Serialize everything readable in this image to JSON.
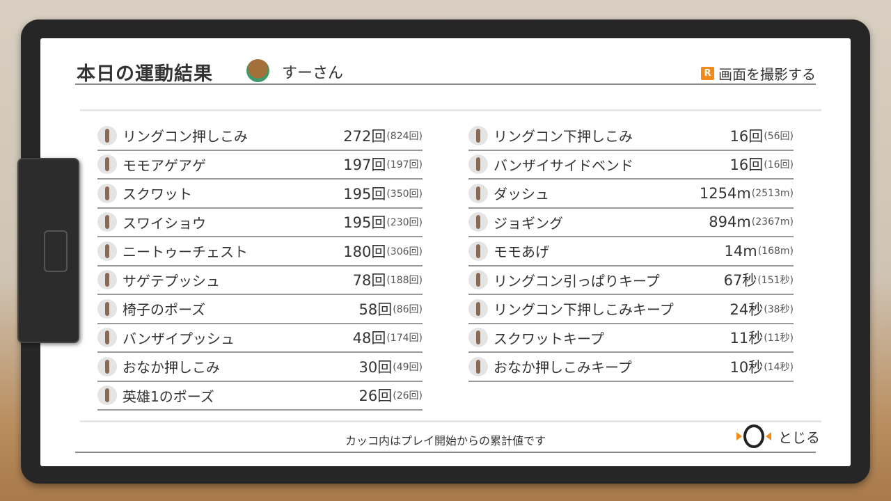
{
  "header": {
    "title": "本日の運動結果",
    "user": "すーさん",
    "screenshot_key": "R",
    "screenshot_label": "画面を撮影する"
  },
  "left": [
    {
      "name": "リングコン押しこみ",
      "value": "272回",
      "total": "(824回)"
    },
    {
      "name": "モモアゲアゲ",
      "value": "197回",
      "total": "(197回)"
    },
    {
      "name": "スクワット",
      "value": "195回",
      "total": "(350回)"
    },
    {
      "name": "スワイショウ",
      "value": "195回",
      "total": "(230回)"
    },
    {
      "name": "ニートゥーチェスト",
      "value": "180回",
      "total": "(306回)"
    },
    {
      "name": "サゲテプッシュ",
      "value": "78回",
      "total": "(188回)"
    },
    {
      "name": "椅子のポーズ",
      "value": "58回",
      "total": "(86回)"
    },
    {
      "name": "バンザイプッシュ",
      "value": "48回",
      "total": "(174回)"
    },
    {
      "name": "おなか押しこみ",
      "value": "30回",
      "total": "(49回)"
    },
    {
      "name": "英雄1のポーズ",
      "value": "26回",
      "total": "(26回)"
    }
  ],
  "right": [
    {
      "name": "リングコン下押しこみ",
      "value": "16回",
      "total": "(56回)"
    },
    {
      "name": "バンザイサイドベンド",
      "value": "16回",
      "total": "(16回)"
    },
    {
      "name": "ダッシュ",
      "value": "1254m",
      "total": "(2513m)"
    },
    {
      "name": "ジョギング",
      "value": "894m",
      "total": "(2367m)"
    },
    {
      "name": "モモあげ",
      "value": "14m",
      "total": "(168m)"
    },
    {
      "name": "リングコン引っぱりキープ",
      "value": "67秒",
      "total": "(151秒)"
    },
    {
      "name": "リングコン下押しこみキープ",
      "value": "24秒",
      "total": "(38秒)"
    },
    {
      "name": "スクワットキープ",
      "value": "11秒",
      "total": "(11秒)"
    },
    {
      "name": "おなか押しこみキープ",
      "value": "10秒",
      "total": "(14秒)"
    }
  ],
  "footer": {
    "note": "カッコ内はプレイ開始からの累計値です",
    "close_label": "とじる"
  },
  "colors": {
    "accent": "#f08a1c"
  }
}
